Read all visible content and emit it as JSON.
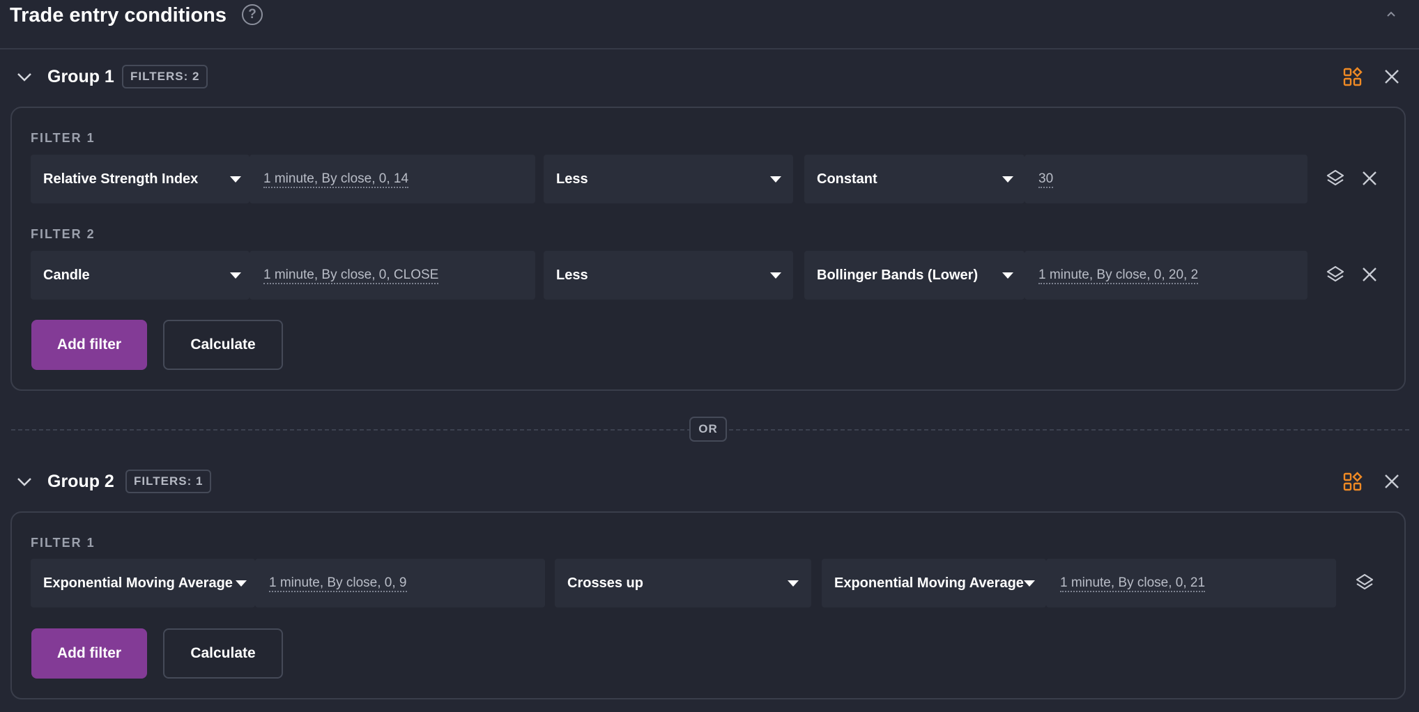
{
  "header": {
    "title": "Trade entry conditions",
    "help_glyph": "?"
  },
  "separator": {
    "label": "OR"
  },
  "colors": {
    "background": "#242733",
    "primary_button": "#833b96",
    "accent_icon": "#f08a24",
    "field_bg": "#2a2e3a"
  },
  "groups": [
    {
      "title": "Group 1",
      "filters_badge": "FILTERS: 2",
      "filters": [
        {
          "label": "FILTER 1",
          "indicator": "Relative Strength Index",
          "indicator_params": "1 minute, By close, 0, 14",
          "condition": "Less",
          "compare_type": "Constant",
          "compare_params": "30"
        },
        {
          "label": "FILTER 2",
          "indicator": "Candle",
          "indicator_params": "1 minute, By close, 0, CLOSE",
          "condition": "Less",
          "compare_type": "Bollinger Bands (Lower)",
          "compare_params": "1 minute, By close, 0, 20, 2"
        }
      ],
      "add_filter_label": "Add filter",
      "calculate_label": "Calculate"
    },
    {
      "title": "Group 2",
      "filters_badge": "FILTERS: 1",
      "filters": [
        {
          "label": "FILTER 1",
          "indicator": "Exponential Moving Average",
          "indicator_params": "1 minute, By close, 0, 9",
          "condition": "Crosses up",
          "compare_type": "Exponential Moving Average",
          "compare_params": "1 minute, By close, 0, 21"
        }
      ],
      "add_filter_label": "Add filter",
      "calculate_label": "Calculate"
    }
  ],
  "icons": {
    "help": "question-circle-icon",
    "collapse_section": "chevron-up-icon",
    "collapse_group": "chevron-down-icon",
    "group_layout": "grid-shapes-icon",
    "group_close": "close-icon",
    "filter_layers": "layers-icon",
    "filter_close": "close-icon"
  }
}
